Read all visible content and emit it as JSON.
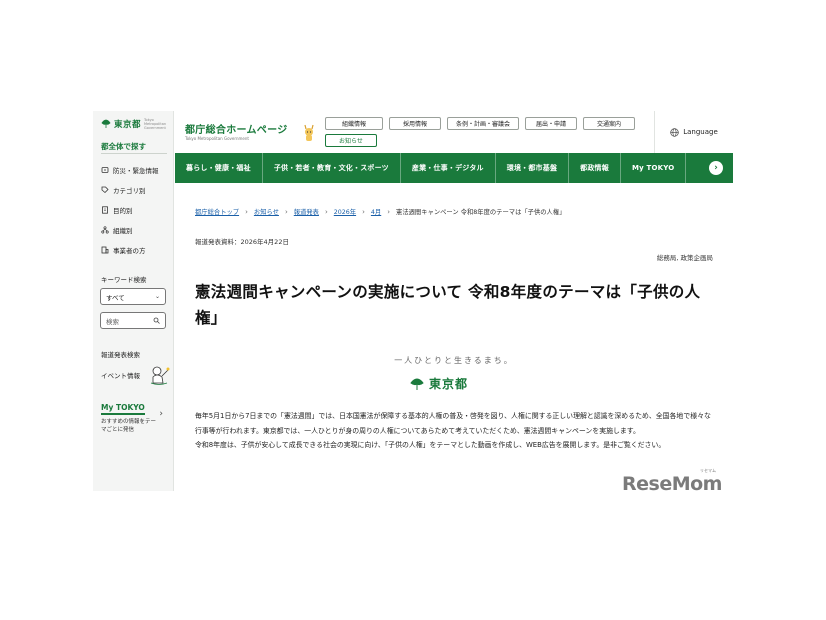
{
  "sidebar": {
    "logo": "東京都",
    "logo_sub": "Tokyo Metropolitan Government",
    "search_all": "都全体で探す",
    "items": [
      {
        "label": "防災・緊急情報",
        "icon": "alert-icon"
      },
      {
        "label": "カテゴリ別",
        "icon": "tag-icon"
      },
      {
        "label": "目的別",
        "icon": "document-icon"
      },
      {
        "label": "組織別",
        "icon": "org-icon"
      },
      {
        "label": "事業者の方",
        "icon": "building-icon"
      }
    ],
    "keyword_heading": "キーワード検索",
    "select_value": "すべて",
    "search_placeholder": "検索",
    "links": [
      "報道発表検索",
      "イベント情報"
    ],
    "mytokyo_title": "My TOKYO",
    "mytokyo_desc": "おすすめの情報をテーマごとに発信"
  },
  "header": {
    "site_title": "都庁総合ホームページ",
    "site_sub": "Tokyo Metropolitan Government",
    "buttons_row1": [
      "組織情報",
      "採用情報",
      "条例・計画・審議会",
      "届出・申請",
      "交通案内"
    ],
    "button_news": "お知らせ",
    "language": "Language"
  },
  "nav": {
    "items": [
      "暮らし・健康・福祉",
      "子供・若者・教育・文化・スポーツ",
      "産業・仕事・デジタル",
      "環境・都市基盤",
      "都政情報",
      "My TOKYO"
    ]
  },
  "main": {
    "breadcrumb": [
      "都庁総合トップ",
      "お知らせ",
      "報道発表",
      "2026年",
      "4月"
    ],
    "breadcrumb_current": "憲法週間キャンペーン 令和8年度のテーマは「子供の人権」",
    "date": "報道発表資料：2026年4月22日",
    "dept": "総務局, 政策企画局",
    "title": "憲法週間キャンペーンの実施について 令和8年度のテーマは「子供の人権」",
    "banner_tagline": "一人ひとりと生きるまち。",
    "banner_logo": "東京都",
    "body": [
      "毎年5月1日から7日までの「憲法週間」では、日本国憲法が保障する基本的人権の普及・啓発を図り、人権に関する正しい理解と認識を深めるため、全国各地で様々な行事等が行われます。東京都では、一人ひとりが身の周りの人権についてあらためて考えていただくため、憲法週間キャンペーンを実施します。",
      "令和8年度は、子供が安心して成長できる社会の実現に向け、「子供の人権」をテーマとした動画を作成し、WEB広告を展開します。是非ご覧ください。"
    ]
  },
  "watermark": {
    "text": "ReseMom",
    "ruby": "リセマム"
  },
  "colors": {
    "brand_green": "#1a7a3c",
    "link_blue": "#1a5fa8"
  }
}
